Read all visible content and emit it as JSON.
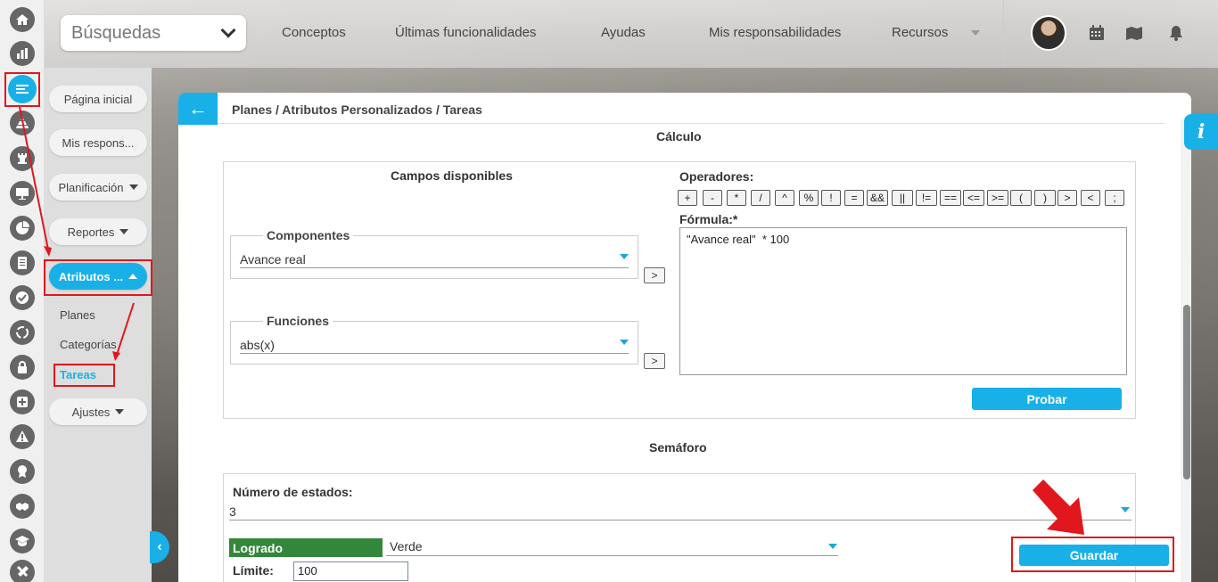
{
  "search": {
    "label": "Búsquedas"
  },
  "topnav": [
    "Conceptos",
    "Últimas funcionalidades",
    "Ayudas",
    "Mis responsabilidades",
    "Recursos"
  ],
  "leftnav": {
    "pills": [
      "Página inicial",
      "Mis respons...",
      "Planificación",
      "Reportes",
      "Atributos ...",
      "Ajustes"
    ],
    "subitems": [
      "Planes",
      "Categorías",
      "Tareas"
    ]
  },
  "breadcrumb": "Planes / Atributos Personalizados / Tareas",
  "calculo": {
    "title": "Cálculo",
    "campos_title": "Campos disponibles",
    "componentes": {
      "legend": "Componentes",
      "value": "Avance real"
    },
    "funciones": {
      "legend": "Funciones",
      "value": "abs(x)"
    },
    "move_btn": ">",
    "operadores_label": "Operadores:",
    "operators": [
      "+",
      "-",
      "*",
      "/",
      "^",
      "%",
      "!",
      "=",
      "&&",
      "||",
      "!=",
      "==",
      "<=",
      ">=",
      "(",
      ")",
      ">",
      "<",
      ";"
    ],
    "formula_label": "Fórmula:*",
    "formula": "\"Avance real\"  * 100",
    "probar": "Probar"
  },
  "semaforo": {
    "title": "Semáforo",
    "estados_label": "Número de estados:",
    "estados_value": "3",
    "logrado": "Logrado",
    "color": "Verde",
    "limite_label": "Límite:",
    "limite_value": "100",
    "guardar": "Guardar"
  },
  "info_label": "i",
  "colors": {
    "accent": "#19b0e8",
    "highlight": "#e0171c",
    "green": "#33873a"
  }
}
